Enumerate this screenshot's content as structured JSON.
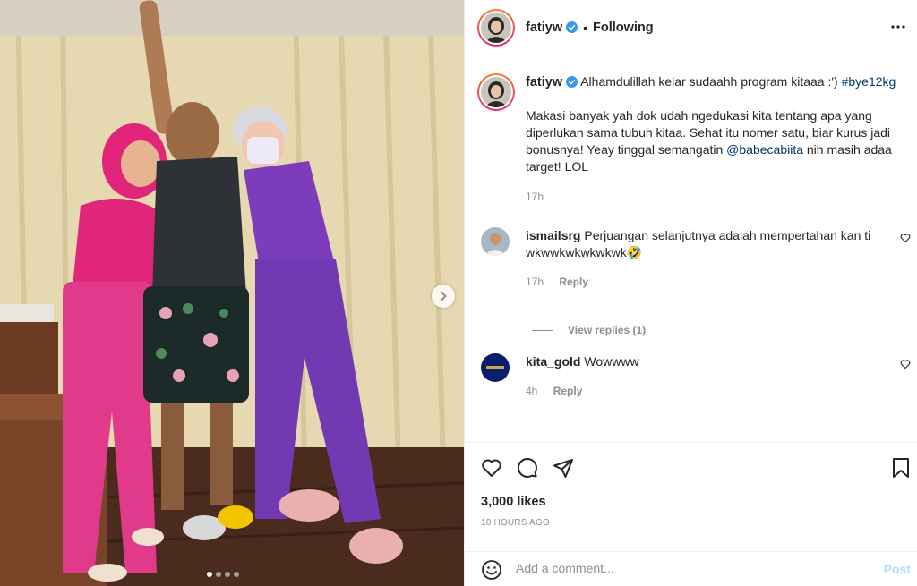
{
  "post": {
    "username": "fatiyw",
    "separator": "•",
    "follow_status": "Following",
    "caption": {
      "line1_text": "Alhamdulillah kelar sudaahh program kitaaa :')",
      "hashtag": "#bye12kg",
      "para_text_before": "Makasi banyak yah dok udah ngedukasi kita tentang apa yang diperlukan sama tubuh kitaa. Sehat itu nomer satu, biar kurus jadi bonusnya! Yeay tinggal semangatin",
      "mention": "@babecabiita",
      "para_text_after": "nih masih adaa target! LOL",
      "time": "17h"
    },
    "comments": [
      {
        "user": "ismailsrg",
        "text": "Perjuangan selanjutnya adalah mempertahan kan ti wkwwkwkwkwkwk🤣",
        "time": "17h",
        "reply_label": "Reply"
      },
      {
        "user": "kita_gold",
        "text": "Wowwww",
        "time": "4h",
        "reply_label": "Reply"
      }
    ],
    "view_replies_label": "View replies (1)",
    "likes": "3,000 likes",
    "posted_ago": "18 HOURS AGO",
    "comment_placeholder": "Add a comment...",
    "post_label": "Post",
    "carousel": {
      "total_slides": 4,
      "active_slide": 1
    }
  },
  "colors": {
    "text": "#262626",
    "muted": "#8e8e8e",
    "link": "#00376b",
    "verified": "#3897f0",
    "post_button": "#b2dffc",
    "border": "#efefef"
  },
  "icons": [
    "verified-badge-icon",
    "more-options-icon",
    "heart-icon",
    "comment-icon",
    "share-icon",
    "bookmark-icon",
    "emoji-icon",
    "chevron-right-icon"
  ]
}
